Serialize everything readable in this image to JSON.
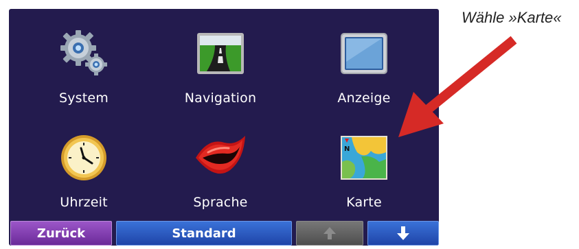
{
  "menu": {
    "items": [
      {
        "label": "System",
        "icon": "gears-icon"
      },
      {
        "label": "Navigation",
        "icon": "road-icon"
      },
      {
        "label": "Anzeige",
        "icon": "display-icon"
      },
      {
        "label": "Uhrzeit",
        "icon": "clock-icon"
      },
      {
        "label": "Sprache",
        "icon": "lips-icon"
      },
      {
        "label": "Karte",
        "icon": "map-icon"
      }
    ]
  },
  "bottombar": {
    "back_label": "Zurück",
    "default_label": "Standard"
  },
  "annotation": {
    "text": "Wähle »Karte«",
    "color": "#d62a26"
  },
  "colors": {
    "screen_bg": "#231b4e",
    "back_button": "#8a45b8",
    "blue_button": "#2f5fc8",
    "disabled_button": "#666666"
  }
}
